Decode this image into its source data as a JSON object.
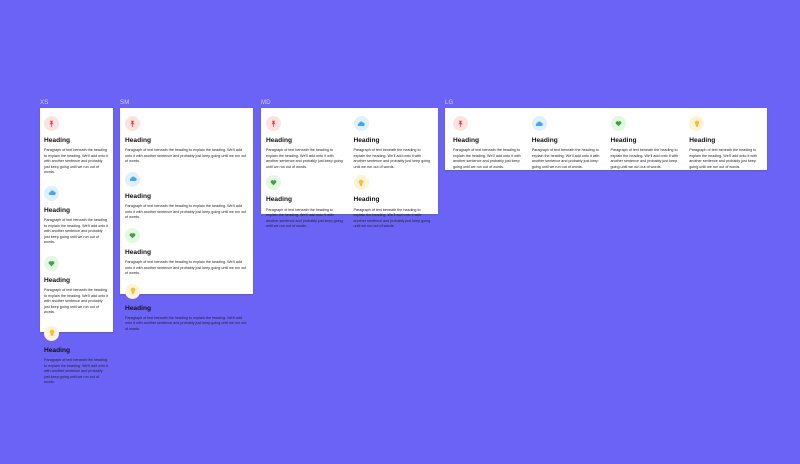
{
  "frames": {
    "xs": {
      "label": "XS"
    },
    "sm": {
      "label": "SM"
    },
    "md": {
      "label": "MD"
    },
    "lg": {
      "label": "LG"
    }
  },
  "cards": [
    {
      "heading": "Heading",
      "icon": "pin-icon",
      "color": "#fde2e2"
    },
    {
      "heading": "Heading",
      "icon": "cloud-icon",
      "color": "#dff1fd"
    },
    {
      "heading": "Heading",
      "icon": "heart-icon",
      "color": "#e2f8e0"
    },
    {
      "heading": "Heading",
      "icon": "lightbulb-icon",
      "color": "#fdf4d6"
    }
  ],
  "paragraph": "Paragraph of text beneath the heading to explain the heading. We'll add onto it with another sentence and probably just keep going until we run out of words."
}
